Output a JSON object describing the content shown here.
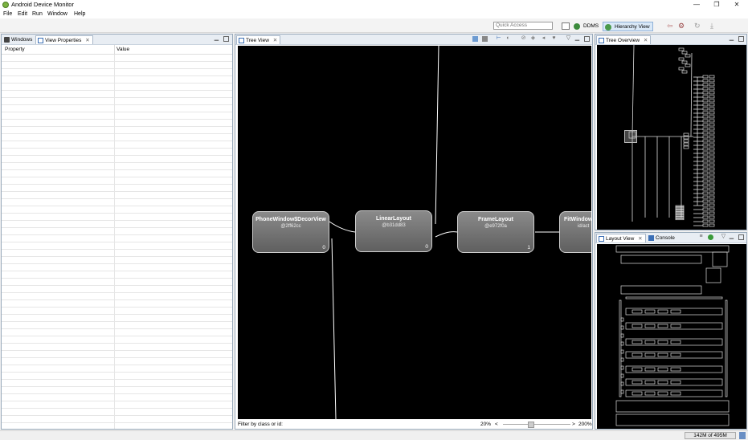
{
  "window": {
    "title": "Android Device Monitor",
    "controls": {
      "minimize": "—",
      "maximize": "❐",
      "close": "✕"
    }
  },
  "menu": [
    "File",
    "Edit",
    "Run",
    "Window",
    "Help"
  ],
  "toolbar": {
    "quick_access_placeholder": "Quick Access",
    "perspectives": [
      {
        "label": "DDMS",
        "active": false,
        "color": "#3b8a3b"
      },
      {
        "label": "Hierarchy View",
        "active": true,
        "color": "#4a9a4a"
      }
    ]
  },
  "left_panel": {
    "tabs": [
      {
        "label": "Windows",
        "active": false
      },
      {
        "label": "View Properties",
        "active": true
      }
    ],
    "columns": [
      "Property",
      "Value"
    ]
  },
  "tree_view": {
    "tab": "Tree View",
    "nodes": [
      {
        "title": "PhoneWindow$DecorView",
        "id": "@2ff62cc",
        "count": "0"
      },
      {
        "title": "LinearLayout",
        "id": "@b31dd83",
        "count": "0"
      },
      {
        "title": "FrameLayout",
        "id": "@e972f0a",
        "count": "1"
      },
      {
        "title": "FitWindow",
        "id": "id/act",
        "count": ""
      }
    ],
    "filter_label": "Filter by class or id:",
    "zoom_min": "20%",
    "zoom_max": "200%",
    "zoom_left_arrow": "<",
    "zoom_right_arrow": ">"
  },
  "tree_overview": {
    "tab": "Tree Overview"
  },
  "bottom_right": {
    "tabs": [
      {
        "label": "Layout View",
        "active": true
      },
      {
        "label": "Console",
        "active": false
      }
    ]
  },
  "status": {
    "memory": "142M of 495M"
  },
  "colors": {
    "accent": "#3b6fb6",
    "canvas": "#000000",
    "node": "#6e6e6e"
  }
}
